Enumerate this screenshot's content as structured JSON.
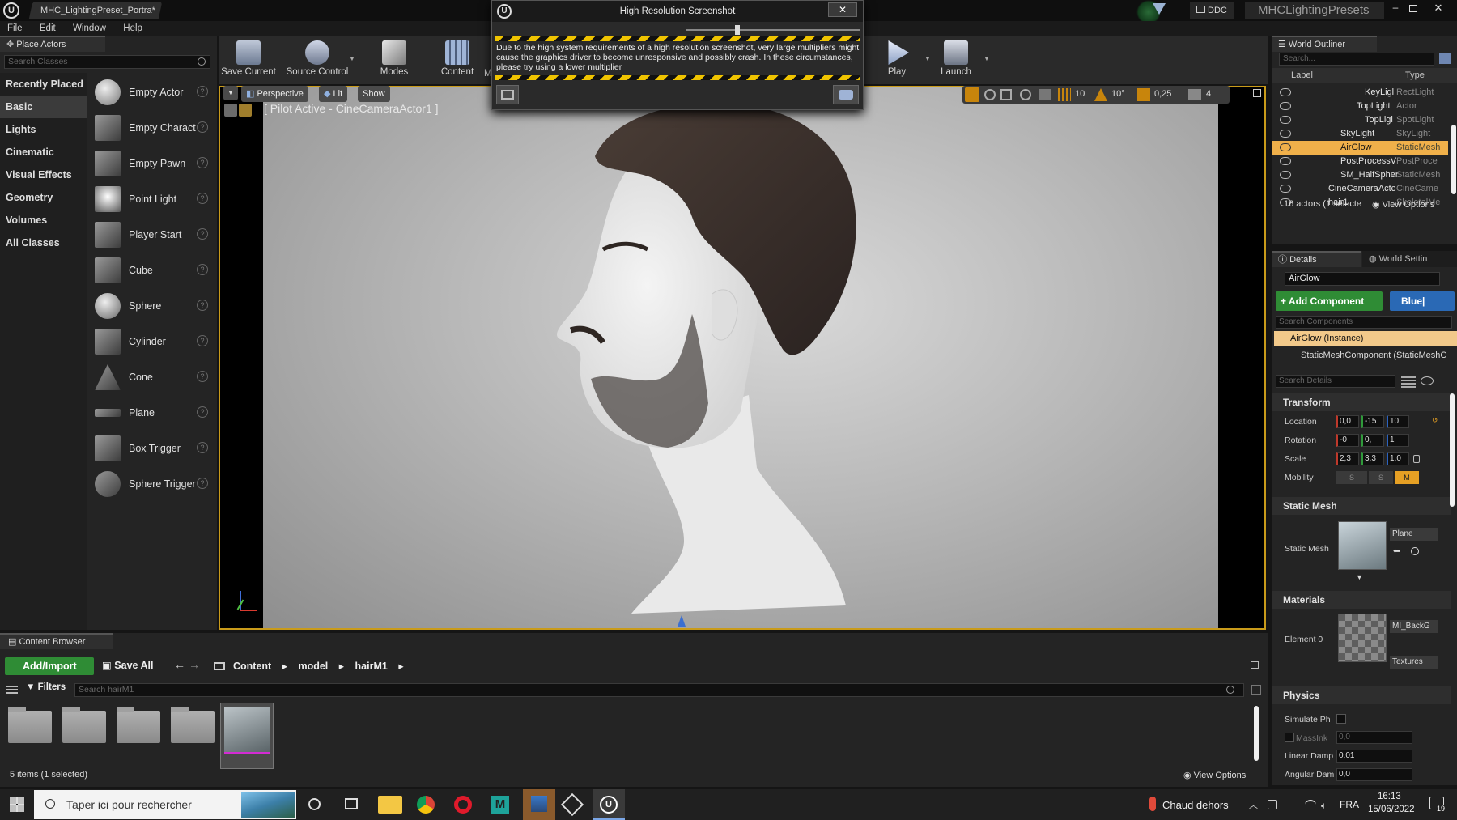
{
  "window": {
    "doc_tab": "MHC_LightingPreset_Portra*",
    "project_name": "MHCLightingPresets",
    "ddc_label": "DDC"
  },
  "menu": [
    "File",
    "Edit",
    "Window",
    "Help"
  ],
  "place_actors": {
    "tab_label": "Place Actors",
    "search_placeholder": "Search Classes",
    "categories": [
      "Recently Placed",
      "Basic",
      "Lights",
      "Cinematic",
      "Visual Effects",
      "Geometry",
      "Volumes",
      "All Classes"
    ],
    "selected_category": "Basic",
    "actors": [
      "Empty Actor",
      "Empty Charact",
      "Empty Pawn",
      "Point Light",
      "Player Start",
      "Cube",
      "Sphere",
      "Cylinder",
      "Cone",
      "Plane",
      "Box Trigger",
      "Sphere Trigger"
    ]
  },
  "toolbar": {
    "save_current": "Save Current",
    "source_control": "Source Control",
    "modes": "Modes",
    "content": "Content",
    "marketplace_partial": "M",
    "play": "Play",
    "launch": "Launch"
  },
  "dialog": {
    "title": "High Resolution Screenshot",
    "close_glyph": "✕",
    "warning_text": "Due to the high system requirements of a high resolution screenshot, very large multipliers might cause the graphics driver to become unresponsive and possibly crash. In these circumstances, please try using a lower multiplier"
  },
  "viewport": {
    "perspective": "Perspective",
    "lit": "Lit",
    "show": "Show",
    "pilot_label": "[ Pilot Active - CineCameraActor1 ]",
    "grid_snap": "10",
    "rotation_snap": "10°",
    "scale_snap": "0,25",
    "camera_speed": "4"
  },
  "outliner": {
    "tab_label": "World Outliner",
    "search_placeholder": "Search...",
    "col_label": "Label",
    "col_type": "Type",
    "rows": [
      {
        "name": "KeyLigl",
        "type": "RectLight"
      },
      {
        "name": "TopLight",
        "type": "Actor"
      },
      {
        "name": "TopLigl",
        "type": "SpotLight"
      },
      {
        "name": "SkyLight",
        "type": "SkyLight"
      },
      {
        "name": "AirGlow",
        "type": "StaticMesh"
      },
      {
        "name": "PostProcessV",
        "type": "PostProce"
      },
      {
        "name": "SM_HalfSpher",
        "type": "StaticMesh"
      },
      {
        "name": "CineCameraActc",
        "type": "CineCame"
      },
      {
        "name": "hair1",
        "type": "SkeletalMe"
      }
    ],
    "status": "16 actors (1 selecte",
    "view_options": "View Options"
  },
  "details": {
    "tab_label": "Details",
    "world_settings_tab": "World Settin",
    "actor_name": "AirGlow",
    "add_component": "+ Add Component",
    "blueprint": "Blue|",
    "search_components_placeholder": "Search Components",
    "instance_label": "AirGlow (Instance)",
    "component_label": "StaticMeshComponent (StaticMeshC",
    "search_details_placeholder": "Search Details",
    "transform": {
      "title": "Transform",
      "location_label": "Location",
      "location": [
        "0,0",
        "-15",
        "10"
      ],
      "rotation_label": "Rotation",
      "rotation": [
        "-0",
        "0,",
        "1"
      ],
      "scale_label": "Scale",
      "scale": [
        "2,3",
        "3,3",
        "1,0"
      ],
      "mobility_label": "Mobility",
      "mobility": [
        "S",
        "S",
        "M"
      ]
    },
    "static_mesh": {
      "title": "Static Mesh",
      "label": "Static Mesh",
      "value": "Plane"
    },
    "materials": {
      "title": "Materials",
      "element_label": "Element 0",
      "value": "MI_BackG",
      "textures": "Textures"
    },
    "physics": {
      "title": "Physics",
      "simulate_label": "Simulate Ph",
      "mass_label": "MassInk",
      "mass_value": "0,0",
      "linear_damping_label": "Linear Damp",
      "linear_damping_value": "0,01",
      "angular_damping_label": "Angular Dam",
      "angular_damping_value": "0,0"
    }
  },
  "content_browser": {
    "tab_label": "Content Browser",
    "add_import": "Add/Import",
    "save_all": "Save All",
    "path": [
      "Content",
      "model",
      "hairM1"
    ],
    "filters": "Filters",
    "search_placeholder": "Search hairM1",
    "status": "5 items (1 selected)",
    "view_options": "View Options"
  },
  "taskbar": {
    "search_placeholder": "Taper ici pour rechercher",
    "weather": "Chaud dehors",
    "language": "FRA",
    "time": "16:13",
    "date": "15/06/2022",
    "notification_count": "19"
  }
}
